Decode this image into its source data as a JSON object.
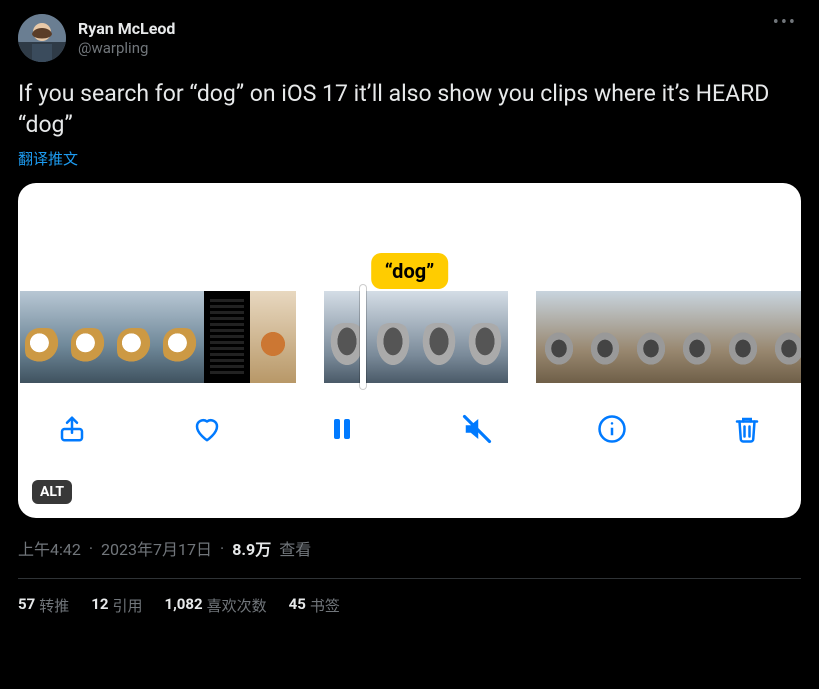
{
  "author": {
    "display_name": "Ryan McLeod",
    "handle": "@warpling"
  },
  "tweet": {
    "text": "If you search for “dog” on iOS 17 it’ll also show you clips where it’s HEARD “dog”",
    "translate_label": "翻译推文"
  },
  "media": {
    "search_term_display": "“dog”",
    "alt_badge": "ALT",
    "controls": {
      "share": "share-icon",
      "like": "heart-icon",
      "pause": "pause-icon",
      "mute": "mute-icon",
      "info": "info-icon",
      "trash": "trash-icon"
    }
  },
  "meta": {
    "time": "上午4:42",
    "date": "2023年7月17日",
    "views_count": "8.9万",
    "views_label": "查看"
  },
  "stats": {
    "retweets": {
      "count": "57",
      "label": "转推"
    },
    "quotes": {
      "count": "12",
      "label": "引用"
    },
    "likes": {
      "count": "1,082",
      "label": "喜欢次数"
    },
    "bookmarks": {
      "count": "45",
      "label": "书签"
    }
  }
}
